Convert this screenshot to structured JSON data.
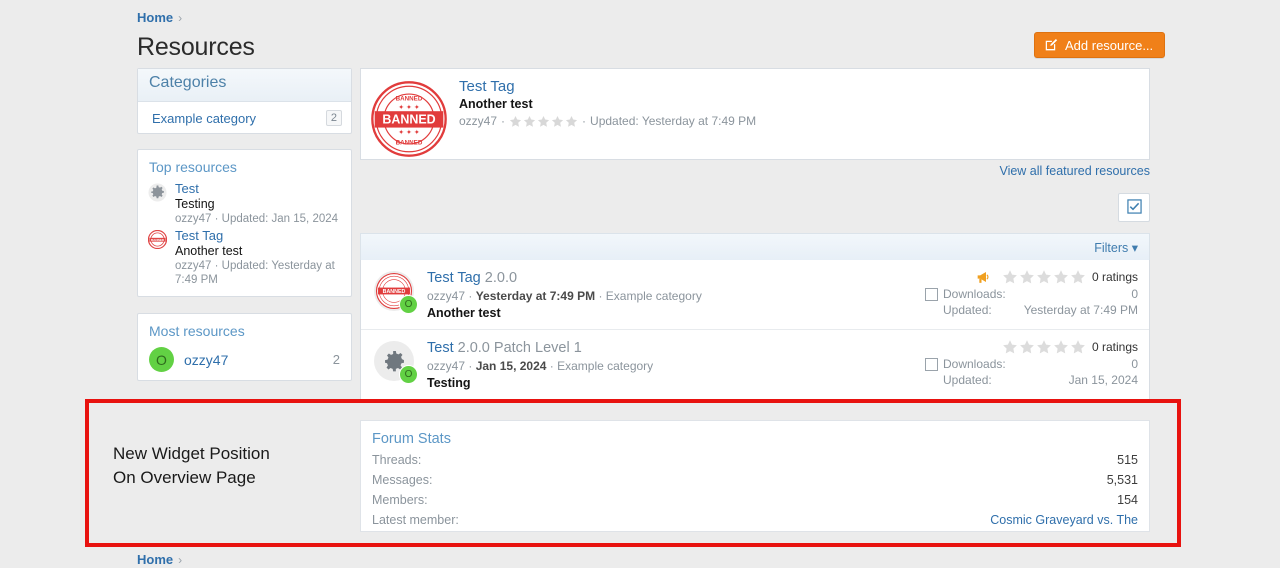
{
  "breadcrumb_top": {
    "home": "Home",
    "sep": "›"
  },
  "breadcrumb_bottom": {
    "home": "Home",
    "sep": "›"
  },
  "page_title": "Resources",
  "add_button": {
    "label": "Add resource...",
    "icon": "edit-square-icon",
    "color": "#f08019"
  },
  "sidebar": {
    "categories": {
      "header": "Categories",
      "items": [
        {
          "label": "Example category",
          "count": "2"
        }
      ]
    },
    "top_resources": {
      "header": "Top resources",
      "items": [
        {
          "icon": "gear-icon",
          "title": "Test",
          "desc": "Testing",
          "meta": "ozzy47 · Updated: Jan 15, 2024"
        },
        {
          "icon": "banned-stamp-icon",
          "title": "Test Tag",
          "desc": "Another test",
          "meta": "ozzy47 · Updated: Yesterday at 7:49 PM"
        }
      ]
    },
    "most_resources": {
      "header": "Most resources",
      "user": {
        "avatar_letter": "O",
        "name": "ozzy47",
        "count": "2"
      }
    }
  },
  "featured": {
    "icon": "banned-stamp-icon",
    "title": "Test Tag",
    "desc": "Another test",
    "author": "ozzy47",
    "sep": "·",
    "rating_stars": 5,
    "updated": "Updated: Yesterday at 7:49 PM",
    "view_all_link": "View all featured resources"
  },
  "toolbar": {
    "select_all_icon": "checkbox-checked-icon",
    "filters_label": "Filters",
    "filters_caret": "▾"
  },
  "resource_list": {
    "rows": [
      {
        "icon": "banned-stamp-icon",
        "badge_letter": "O",
        "title": "Test Tag",
        "version": "2.0.0",
        "author": "ozzy47",
        "date": "Yesterday at 7:49 PM",
        "category": "Example category",
        "tagline": "Another test",
        "featured_icon": "megaphone-icon",
        "checkbox_icon": "checkbox-icon",
        "ratings_label": "0 ratings",
        "downloads_label": "Downloads:",
        "downloads_value": "0",
        "updated_label": "Updated:",
        "updated_value": "Yesterday at 7:49 PM"
      },
      {
        "icon": "gear-icon",
        "badge_letter": "O",
        "title": "Test",
        "version": "2.0.0 Patch Level 1",
        "author": "ozzy47",
        "date": "Jan 15, 2024",
        "category": "Example category",
        "tagline": "Testing",
        "featured_icon": "",
        "checkbox_icon": "checkbox-icon",
        "ratings_label": "0 ratings",
        "downloads_label": "Downloads:",
        "downloads_value": "0",
        "updated_label": "Updated:",
        "updated_value": "Jan 15, 2024"
      }
    ]
  },
  "highlight": {
    "border_color": "#e8120f",
    "annotation_line1": "New Widget Position",
    "annotation_line2": "On Overview Page"
  },
  "forum_stats": {
    "title": "Forum Stats",
    "rows": [
      {
        "label": "Threads:",
        "value": "515",
        "is_link": false
      },
      {
        "label": "Messages:",
        "value": "5,531",
        "is_link": false
      },
      {
        "label": "Members:",
        "value": "154",
        "is_link": false
      },
      {
        "label": "Latest member:",
        "value": "Cosmic Graveyard vs. The",
        "is_link": true
      }
    ]
  }
}
